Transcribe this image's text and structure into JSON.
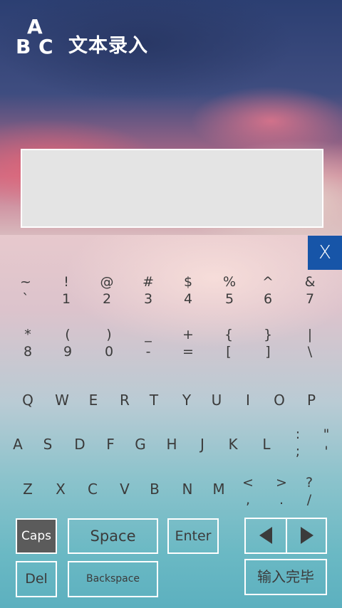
{
  "header": {
    "logo_letters": [
      "A",
      "B",
      "C"
    ],
    "title": "文本录入"
  },
  "close_button": "X",
  "symbol_rows": [
    [
      {
        "top": "~",
        "bottom": "`"
      },
      {
        "top": "!",
        "bottom": "1"
      },
      {
        "top": "@",
        "bottom": "2"
      },
      {
        "top": "#",
        "bottom": "3"
      },
      {
        "top": "$",
        "bottom": "4"
      },
      {
        "top": "%",
        "bottom": "5"
      },
      {
        "top": "^",
        "bottom": "6"
      },
      {
        "top": "&",
        "bottom": "7"
      }
    ],
    [
      {
        "top": "*",
        "bottom": "8"
      },
      {
        "top": "(",
        "bottom": "9"
      },
      {
        "top": ")",
        "bottom": "0"
      },
      {
        "top": "_",
        "bottom": "-"
      },
      {
        "top": "+",
        "bottom": "="
      },
      {
        "top": "{",
        "bottom": "["
      },
      {
        "top": "}",
        "bottom": "]"
      },
      {
        "top": "|",
        "bottom": "\\"
      }
    ]
  ],
  "letter_rows": [
    [
      "Q",
      "W",
      "E",
      "R",
      "T",
      "Y",
      "U",
      "I",
      "O",
      "P"
    ],
    [
      "A",
      "S",
      "D",
      "F",
      "G",
      "H",
      "J",
      "K",
      "L"
    ],
    [
      "Z",
      "X",
      "C",
      "V",
      "B",
      "N",
      "M"
    ]
  ],
  "row2_extra": {
    "top": ":",
    "bottom": ";"
  },
  "row2_extra2": {
    "top": "\"",
    "bottom": "'"
  },
  "row3_extra": [
    {
      "top": "<",
      "bottom": ","
    },
    {
      "top": ">",
      "bottom": "."
    },
    {
      "top": "?",
      "bottom": "/"
    }
  ],
  "buttons": {
    "caps": "Caps",
    "space": "Space",
    "enter": "Enter",
    "del": "Del",
    "backspace": "Backspace",
    "done": "输入完毕"
  }
}
